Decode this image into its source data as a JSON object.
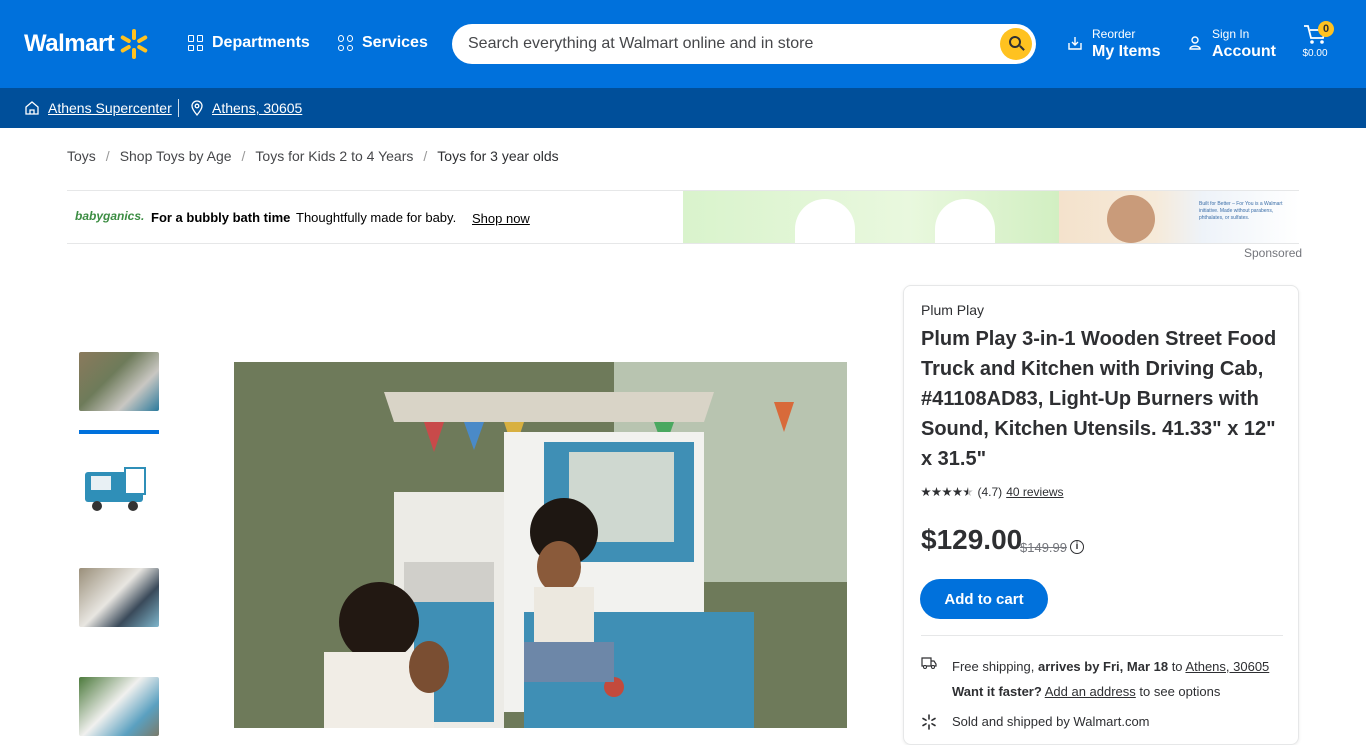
{
  "header": {
    "logo_text": "Walmart",
    "departments": "Departments",
    "services": "Services",
    "search_placeholder": "Search everything at Walmart online and in store",
    "reorder_small": "Reorder",
    "reorder_big": "My Items",
    "signin_small": "Sign In",
    "signin_big": "Account",
    "cart_count": "0",
    "cart_total": "$0.00",
    "brand_color": "#0071dc",
    "accent_color": "#ffc220"
  },
  "subbar": {
    "store": "Athens Supercenter",
    "location": "Athens, 30605"
  },
  "breadcrumb": [
    "Toys",
    "Shop Toys by Age",
    "Toys for Kids 2 to 4 Years",
    "Toys for 3 year olds"
  ],
  "ad": {
    "brand": "babyganics.",
    "headline": "For a bubbly bath time",
    "subtext": "Thoughtfully made for baby.",
    "cta": "Shop now",
    "note": "Built for Better – For You is a Walmart initiative. Made without parabens, phthalates, or sulfates.",
    "sponsored": "Sponsored"
  },
  "product": {
    "brand": "Plum Play",
    "title": "Plum Play 3-in-1 Wooden Street Food Truck and Kitchen with Driving Cab, #41108AD83, Light-Up Burners with Sound, Kitchen Utensils. 41.33\" x 12\" x 31.5\"",
    "rating_value": 4.7,
    "rating_text": "(4.7)",
    "reviews": "40 reviews",
    "price": "$129.00",
    "was_price": "$149.99",
    "add_to_cart": "Add to cart",
    "shipping_prefix": "Free shipping, ",
    "shipping_bold": "arrives by Fri, Mar 18",
    "shipping_to": " to ",
    "shipping_location": "Athens, 30605",
    "faster_bold": "Want it faster?",
    "add_address": "Add an address",
    "faster_suffix": " to see options",
    "sold_by": "Sold and shipped by Walmart.com"
  }
}
